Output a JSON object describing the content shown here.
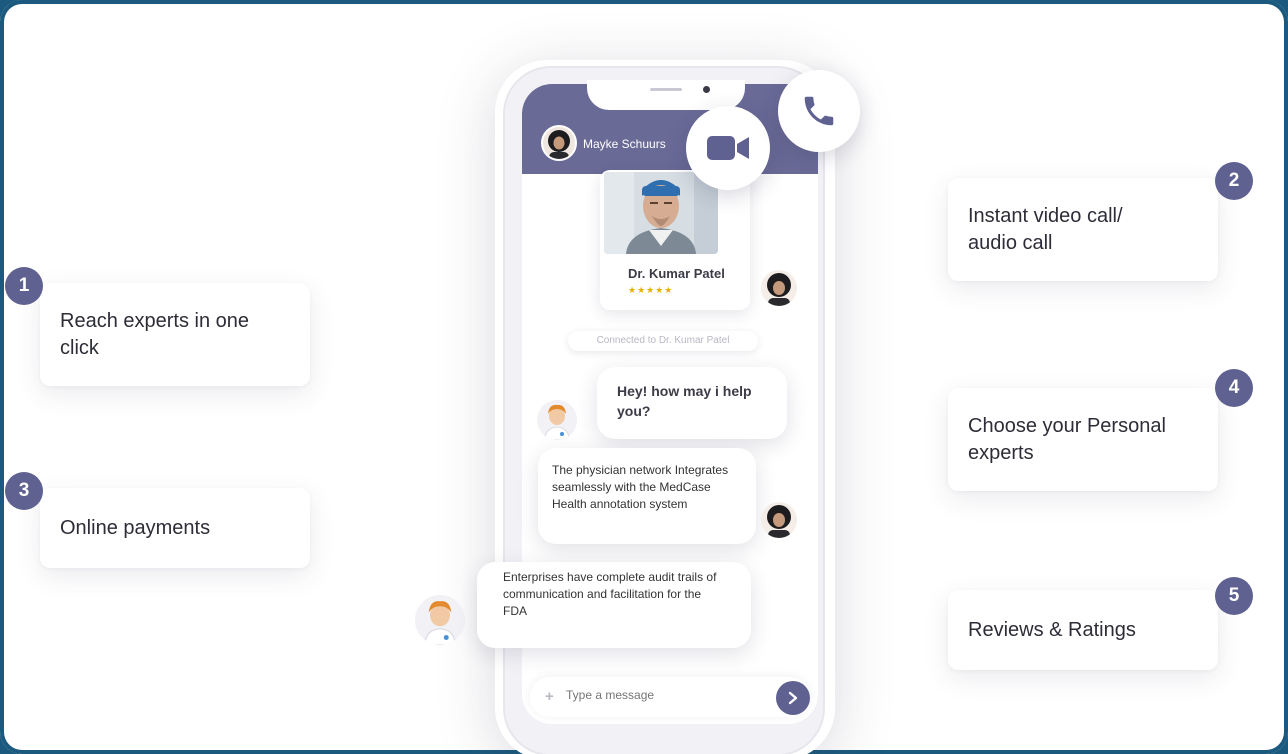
{
  "features": [
    {
      "number": "1",
      "text": "Reach experts in one click"
    },
    {
      "number": "2",
      "text": "Instant video call/ audio call"
    },
    {
      "number": "3",
      "text": "Online payments"
    },
    {
      "number": "4",
      "text": "Choose your Personal experts"
    },
    {
      "number": "5",
      "text": "Reviews & Ratings"
    }
  ],
  "phone": {
    "contact_name": "Mayke Schuurs",
    "doctor_card": {
      "name": "Dr. Kumar Patel",
      "stars": "★★★★★"
    },
    "connected_text": "Connected to Dr. Kumar Patel",
    "messages": [
      {
        "text": "Hey! how may i help you?",
        "from": "doctor"
      },
      {
        "text": "The physician network Integrates seamlessly with the MedCase Health annotation system",
        "from": "user"
      },
      {
        "text": "Enterprises have complete audit trails of communication and facilitation for the FDA",
        "from": "doctor"
      }
    ],
    "input_placeholder": "Type a message",
    "icons": {
      "video": "video-camera-icon",
      "phone": "phone-icon",
      "send": "send-icon",
      "add": "plus-icon"
    }
  },
  "colors": {
    "accent": "#5f6191",
    "header": "#6a6a97",
    "frame": "#1b5a7e"
  }
}
